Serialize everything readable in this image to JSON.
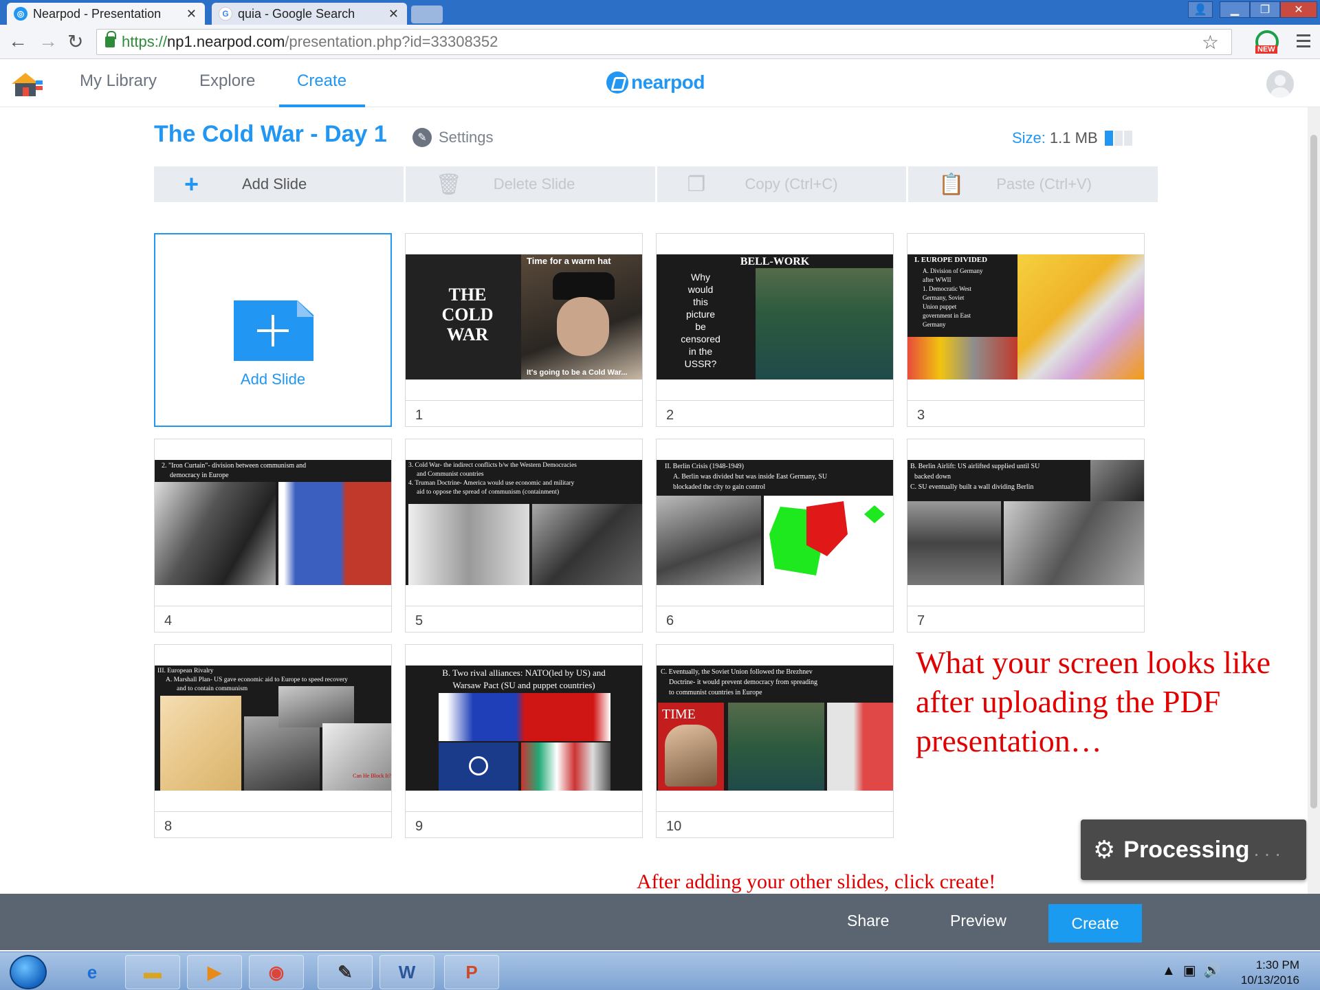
{
  "browser": {
    "tabs": [
      {
        "title": "Nearpod - Presentation",
        "favicon": "nearpod-icon",
        "active": true
      },
      {
        "title": "quia - Google Search",
        "favicon": "google-icon",
        "active": false
      }
    ],
    "url_scheme": "https://",
    "url_host": "np1.nearpod.com",
    "url_path": "/presentation.php?id=33308352",
    "extension_badge": "NEW"
  },
  "nav": {
    "my_library": "My Library",
    "explore": "Explore",
    "create": "Create",
    "active": "Create",
    "logo": "nearpod"
  },
  "presentation": {
    "title": "The Cold War - Day 1",
    "settings_label": "Settings",
    "size_label": "Size:",
    "size_value": "1.1 MB",
    "size_fraction": 0.33
  },
  "toolbar": {
    "add_slide": "Add Slide",
    "delete_slide": "Delete Slide",
    "copy": "Copy (Ctrl+C)",
    "paste": "Paste (Ctrl+V)"
  },
  "add_card_label": "Add Slide",
  "slides": [
    {
      "number": "1",
      "lines": [
        "THE",
        "COLD",
        "WAR"
      ],
      "caption_top": "Time for a warm hat",
      "caption_bottom": "It's going to be a Cold War..."
    },
    {
      "number": "2",
      "heading": "BELL-WORK",
      "lines": [
        "Why",
        "would",
        "this",
        "picture",
        "be",
        "censored",
        "in the",
        "USSR?"
      ]
    },
    {
      "number": "3",
      "heading": "I. EUROPE DIVIDED",
      "body": [
        "A. Division of Germany",
        "after WWII",
        "1. Democratic West",
        "Germany, Soviet",
        "Union puppet",
        "government in East",
        "Germany"
      ]
    },
    {
      "number": "4",
      "body": [
        "2. \"Iron Curtain\"- division between communism and",
        "democracy in Europe"
      ]
    },
    {
      "number": "5",
      "body": [
        "3. Cold War- the indirect conflicts b/w the Western Democracies",
        "and Communist countries",
        "4. Truman Doctrine- America would use economic and military",
        "aid to oppose the spread of communism (containment)"
      ]
    },
    {
      "number": "6",
      "body": [
        "II. Berlin Crisis (1948-1949)",
        "A. Berlin was divided but was inside East Germany, SU",
        "blockaded the city to gain control"
      ]
    },
    {
      "number": "7",
      "body": [
        "B. Berlin Airlift: US airlifted supplied until SU",
        "backed down",
        "C. SU eventually built a wall dividing Berlin"
      ]
    },
    {
      "number": "8",
      "body": [
        "III. European Rivalry",
        "A. Marshall Plan- US gave economic aid to Europe to speed recovery",
        "and to contain communism"
      ],
      "caption": "Can He Block It?"
    },
    {
      "number": "9",
      "body": [
        "B. Two rival alliances: NATO(led by US) and",
        "Warsaw Pact (SU and puppet countries)"
      ]
    },
    {
      "number": "10",
      "body": [
        "C. Eventually, the Soviet Union followed the Brezhnev",
        "Doctrine- it would prevent democracy from spreading",
        "to communist countries in Europe"
      ],
      "magazine": "TIME"
    }
  ],
  "annotation": "What your screen looks like after uploading the PDF presentation…",
  "processing": {
    "label": "Processing",
    "dots": ". . ."
  },
  "hint": "After adding your other slides, click create!",
  "footer": {
    "share": "Share",
    "preview": "Preview",
    "create": "Create"
  },
  "taskbar": {
    "time": "1:30 PM",
    "date": "10/13/2016"
  },
  "colors": {
    "accent": "#2196f3",
    "annotation": "#e00000",
    "footer": "#5b6572"
  }
}
